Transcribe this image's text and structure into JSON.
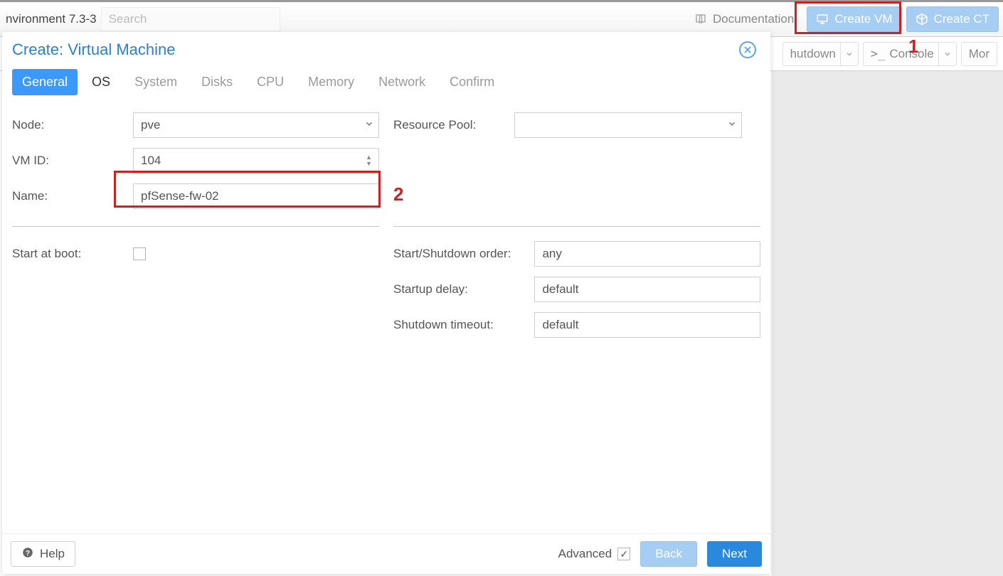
{
  "topbar": {
    "version_text": "nvironment 7.3-3",
    "search_placeholder": "Search",
    "documentation_label": "Documentation",
    "create_vm_label": "Create VM",
    "create_ct_label": "Create CT"
  },
  "secbar": {
    "shutdown_label": "hutdown",
    "console_label": "Console",
    "more_label": "Mor"
  },
  "modal": {
    "title": "Create: Virtual Machine",
    "tabs": {
      "general": "General",
      "os": "OS",
      "system": "System",
      "disks": "Disks",
      "cpu": "CPU",
      "memory": "Memory",
      "network": "Network",
      "confirm": "Confirm"
    },
    "labels": {
      "node": "Node:",
      "vmid": "VM ID:",
      "name": "Name:",
      "start_at_boot": "Start at boot:",
      "resource_pool": "Resource Pool:",
      "start_shutdown_order": "Start/Shutdown order:",
      "startup_delay": "Startup delay:",
      "shutdown_timeout": "Shutdown timeout:"
    },
    "values": {
      "node": "pve",
      "vmid": "104",
      "name": "pfSense-fw-02",
      "resource_pool": "",
      "start_at_boot": false,
      "start_order": "any",
      "startup_delay": "default",
      "shutdown_timeout": "default"
    },
    "footer": {
      "help": "Help",
      "advanced": "Advanced",
      "advanced_checked": true,
      "back": "Back",
      "next": "Next"
    }
  },
  "annotations": {
    "num1": "1",
    "num2": "2"
  }
}
